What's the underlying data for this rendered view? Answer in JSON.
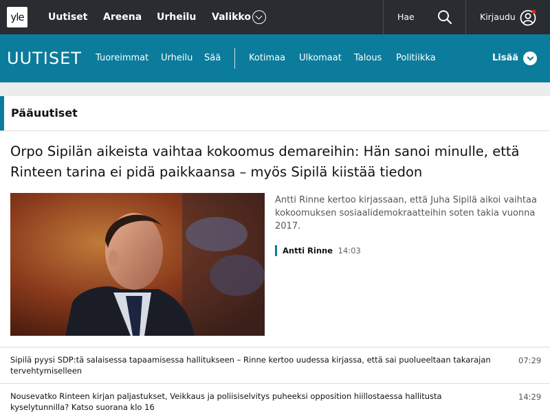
{
  "topbar": {
    "logo": "yle",
    "nav": [
      "Uutiset",
      "Areena",
      "Urheilu",
      "Valikko"
    ],
    "search_label": "Hae",
    "login_label": "Kirjaudu",
    "bg_color": "#292c30"
  },
  "subnav": {
    "brand": "UUTISET",
    "items": [
      "Tuoreimmat",
      "Urheilu",
      "Sää",
      "Kotimaa",
      "Ulkomaat",
      "Talous",
      "Politiikka"
    ],
    "more_label": "Lisää",
    "accent_color": "#0b7c9c"
  },
  "section": {
    "title": "Pääuutiset"
  },
  "main_story": {
    "headline": "Orpo Sipilän aikeista vaihtaa kokoomus demareihin: Hän sanoi minulle, että Rinteen tarina ei pidä paikkaansa – myös Sipilä kiistää tiedon",
    "lead": "Antti Rinne kertoo kirjassaan, että Juha Sipilä aikoi vaihtaa kokoomuksen sosiaalidemokraatteihin soten takia vuonna 2017.",
    "author": "Antti Rinne",
    "time": "14:03"
  },
  "stories": [
    {
      "title": "Sipilä pyysi SDP:tä salaisessa tapaamisessa hallitukseen – Rinne kertoo uudessa kirjassa, että sai puolueeltaan takarajan tervehtymiselleen",
      "time": "07:29"
    },
    {
      "title": "Nousevatko Rinteen kirjan paljastukset, Veikkaus ja poliisiselvitys puheeksi opposition hiillostaessa hallitusta kyselytunnilla? Katso suorana klo 16",
      "time": "14:29"
    }
  ]
}
